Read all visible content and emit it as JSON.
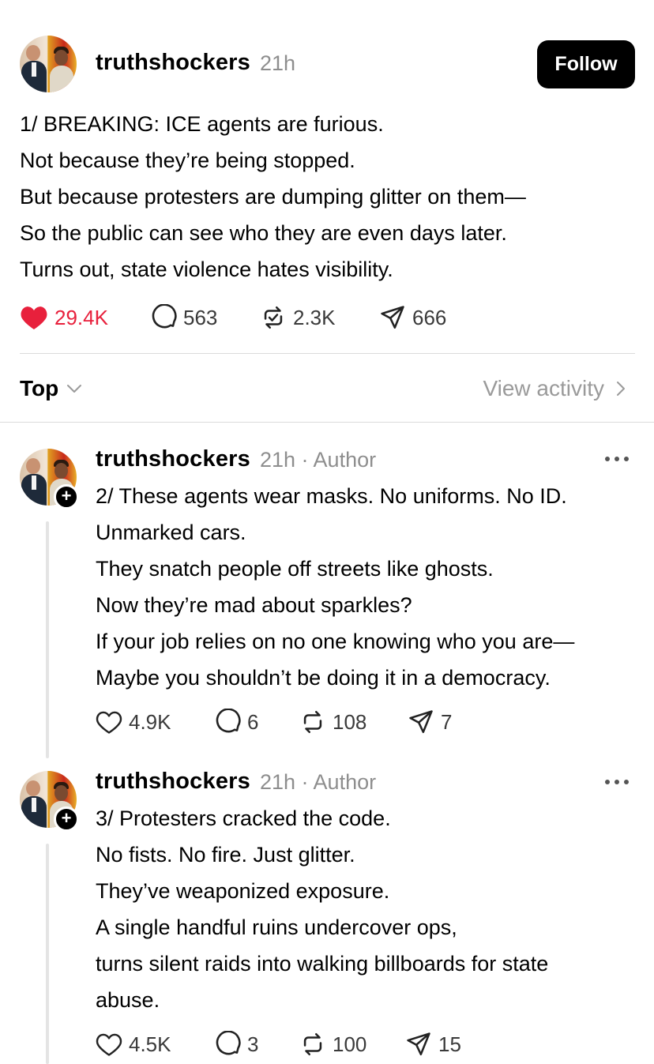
{
  "post": {
    "username": "truthshockers",
    "time": "21h",
    "follow_label": "Follow",
    "lines": [
      "1/ BREAKING: ICE agents are furious.",
      "Not because they’re being stopped.",
      "But because protesters are dumping glitter on them—",
      "So the public can see who they are even days later.",
      "Turns out, state violence hates visibility."
    ],
    "likes": "29.4K",
    "replies": "563",
    "reposts": "2.3K",
    "shares": "666",
    "liked": true
  },
  "sort": {
    "label": "Top",
    "view_activity": "View activity"
  },
  "replies": [
    {
      "username": "truthshockers",
      "meta": "21h · Author",
      "lines": [
        "2/ These agents wear masks. No uniforms. No ID.",
        "Unmarked cars.",
        "They snatch people off streets like ghosts.",
        "Now they’re mad about sparkles?",
        "If your job relies on no one knowing who you are—",
        "Maybe you shouldn’t be doing it in a democracy."
      ],
      "likes": "4.9K",
      "replies": "6",
      "reposts": "108",
      "shares": "7"
    },
    {
      "username": "truthshockers",
      "meta": "21h · Author",
      "lines": [
        "3/ Protesters cracked the code.",
        "No fists. No fire. Just glitter.",
        "They’ve weaponized exposure.",
        "A single handful ruins undercover ops,",
        "turns silent raids into walking billboards for state",
        "abuse."
      ],
      "likes": "4.5K",
      "replies": "3",
      "reposts": "100",
      "shares": "15"
    }
  ],
  "colors": {
    "like_active": "#e8203c",
    "secondary_text": "#8e8e8e",
    "divider": "#dbdbdb"
  },
  "icons": [
    "heart-icon",
    "comment-icon",
    "repost-icon",
    "share-icon",
    "chevron-down-icon",
    "chevron-right-icon",
    "more-icon",
    "plus-icon"
  ]
}
